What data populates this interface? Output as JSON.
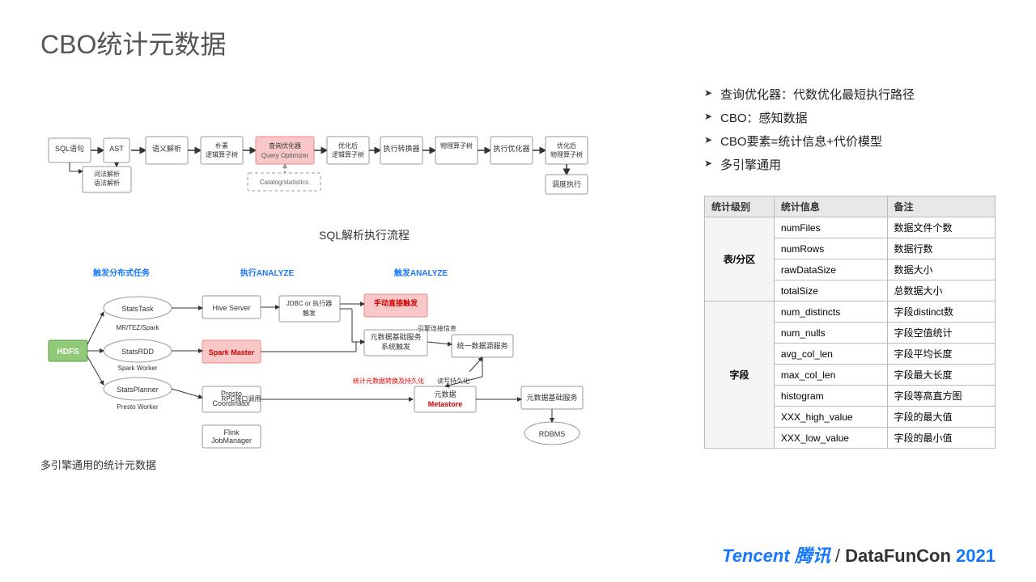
{
  "title": "CBO统计元数据",
  "points": [
    "查询优化器：代数优化最短执行路径",
    "CBO：感知数据",
    "CBO要素=统计信息+代价模型",
    "多引擎通用"
  ],
  "flow_label": "SQL解析执行流程",
  "bottom_label": "多引擎通用的统计元数据",
  "catalog_label": "Catalog/statistics",
  "stats_table": {
    "headers": [
      "统计级别",
      "统计信息",
      "备注"
    ],
    "rows": [
      {
        "category": "表/分区",
        "items": [
          {
            "name": "numFiles",
            "note": "数据文件个数"
          },
          {
            "name": "numRows",
            "note": "数据行数"
          },
          {
            "name": "rawDataSize",
            "note": "数据大小"
          },
          {
            "name": "totalSize",
            "note": "总数据大小"
          }
        ]
      },
      {
        "category": "字段",
        "items": [
          {
            "name": "num_distincts",
            "note": "字段distinct数"
          },
          {
            "name": "num_nulls",
            "note": "字段空值统计"
          },
          {
            "name": "avg_col_len",
            "note": "字段平均长度"
          },
          {
            "name": "max_col_len",
            "note": "字段最大长度"
          },
          {
            "name": "histogram",
            "note": "字段等高直方图"
          },
          {
            "name": "XXX_high_value",
            "note": "字段的最大值"
          },
          {
            "name": "XXX_low_value",
            "note": "字段的最小值"
          }
        ]
      }
    ]
  },
  "footer": {
    "tencent_en": "Tencent",
    "tencent_cn": "腾讯",
    "slash": " / ",
    "datafuncon": "DataFunCon",
    "year": " 2021"
  },
  "flow_nodes": {
    "sql": "SQL语句",
    "ast": "AST",
    "lexer": "词法解析\n语法解析",
    "semantic": "语义解析",
    "logical": "朴素\n逻辑算子树",
    "optimizer": "查询优化器\nQuery Optimizer",
    "opt_logical": "优化后\n逻辑算子树",
    "exec_transform": "执行转换器",
    "physical": "物理算子树",
    "exec_optimizer": "执行优化器",
    "opt_physical": "优化后\n物理算子树",
    "schedule": "调度执行"
  },
  "bottom_nodes": {
    "hdfs": "HDFS",
    "stats_task": "StatsTask",
    "stats_rdd": "StatsRDD",
    "stats_planner": "StatsPlanner",
    "mr_tez": "MR/TEZ/Spark",
    "spark_worker": "Spark Worker",
    "presto_worker": "Presto Worker",
    "hive_server": "Hive Server",
    "spark_master": "Spark Master",
    "presto_coord": "Presto\nCoordinator",
    "flink_jm": "Flink\nJobManager",
    "jdbc_trigger": "JDBC or 执行器\n触发",
    "manual_trigger": "手动直接触发",
    "meta_svc": "元数据基础服务\n系统触发",
    "meta_metastore": "元数据\nMetastore",
    "meta_base_svc": "元数据基础服务",
    "unified_data": "统一数据源服务",
    "rdbms": "RDBMS",
    "trigger1_label": "触发分布式任务",
    "trigger2_label": "执行ANALYZE",
    "trigger3_label": "触发ANALYZE",
    "rpc_label": "RPC接口调用",
    "persist_label": "读写持久化",
    "persist2_label": "统计元数据转换及持久化",
    "conn_label": "引擎连接信息"
  }
}
